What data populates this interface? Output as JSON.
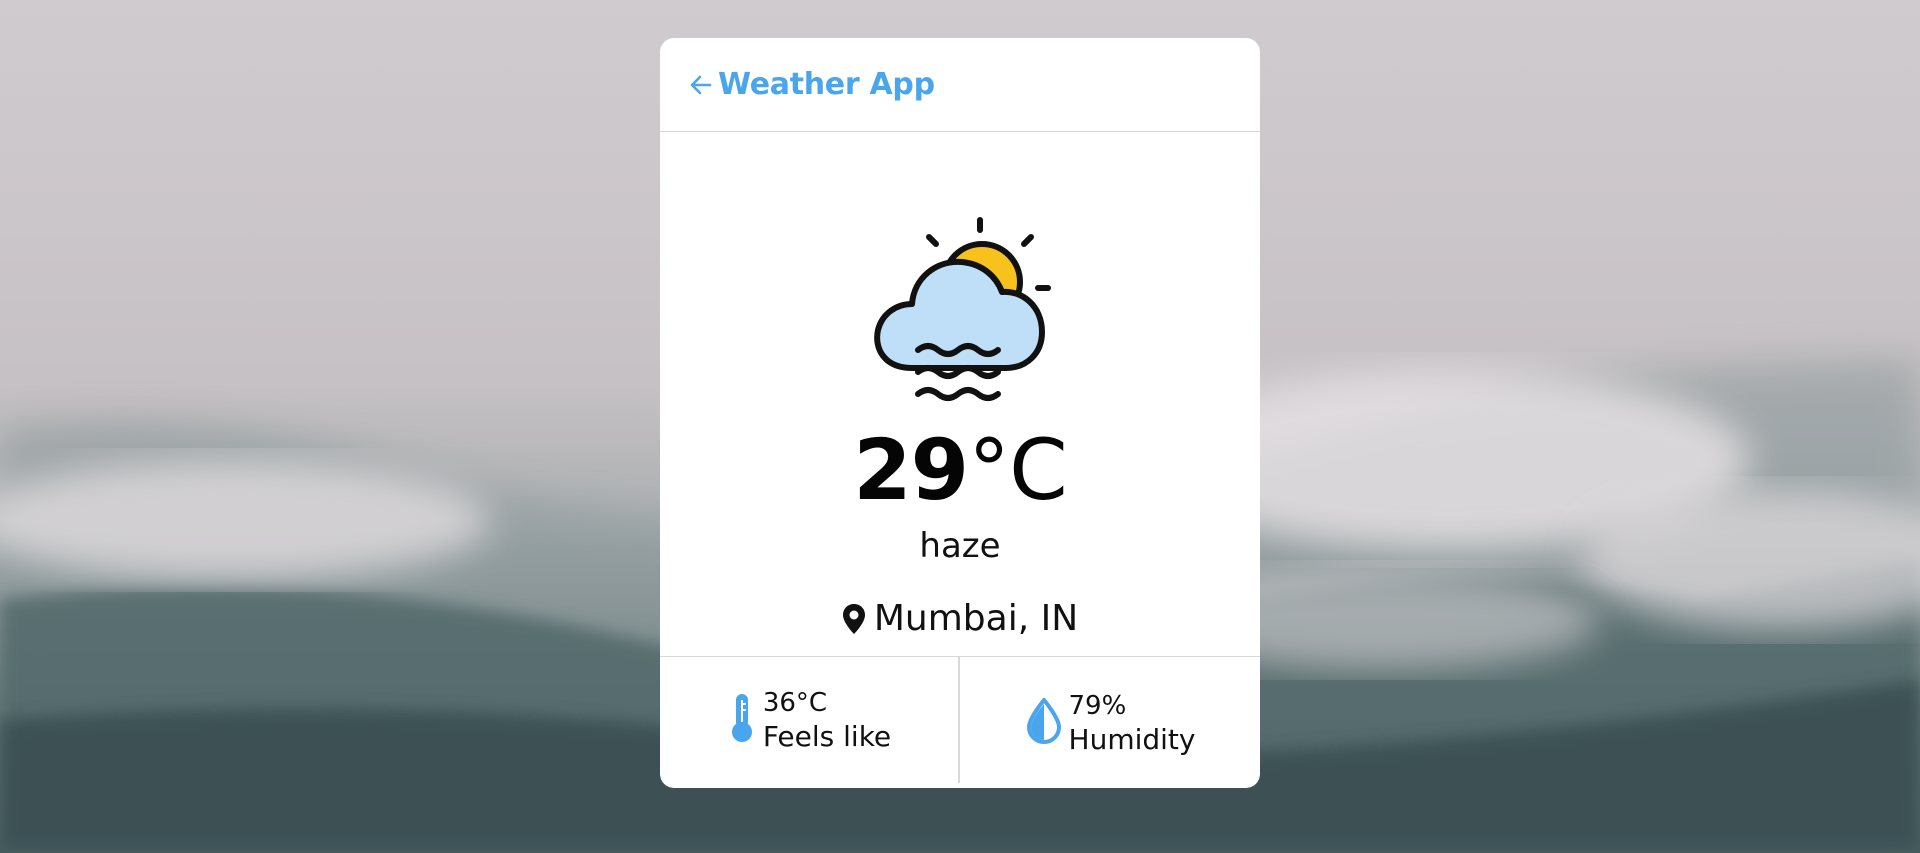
{
  "app": {
    "title": "Weather App"
  },
  "icons": {
    "back": "arrow-left-icon",
    "weather": "haze-cloud-sun-icon",
    "location": "map-pin-icon",
    "feels_like": "thermometer-icon",
    "humidity": "water-drop-icon"
  },
  "weather": {
    "temperature_value": "29",
    "temperature_unit": "°C",
    "condition": "haze",
    "location": "Mumbai, IN"
  },
  "stats": {
    "feels_like": {
      "value": "36°C",
      "label": "Feels like"
    },
    "humidity": {
      "value": "79%",
      "label": "Humidity"
    }
  },
  "colors": {
    "accent": "#4aa6ec",
    "card": "#ffffff",
    "text": "#111111",
    "sun": "#f7c21c",
    "cloud": "#bfdff8"
  }
}
